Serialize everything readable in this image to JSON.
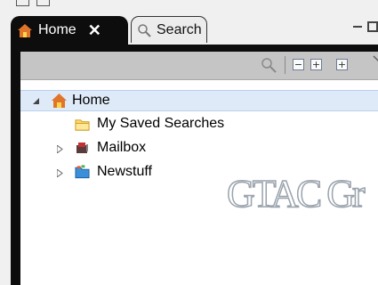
{
  "tabs": [
    {
      "label": "Home",
      "close": "✕",
      "icon": "home-icon",
      "active": true
    },
    {
      "label": "Search",
      "icon": "search-icon",
      "active": false
    }
  ],
  "toolbar": {
    "buttons": [
      "search-icon",
      "collapse-all-icon",
      "expand-icon",
      "expand-all-icon",
      "view-menu-icon"
    ],
    "collapse_glyph": "−",
    "expand_glyph": "+",
    "expand_all_glyph": "+"
  },
  "tree": {
    "items": [
      {
        "label": "Home",
        "icon": "home-icon",
        "expanded": true,
        "selected": true
      },
      {
        "label": "My Saved Searches",
        "icon": "folder-icon"
      },
      {
        "label": "Mailbox",
        "icon": "mailbox-icon",
        "expanded": false
      },
      {
        "label": "Newstuff",
        "icon": "folder-icon",
        "expanded": false
      }
    ]
  },
  "watermark": "GTAC Gr",
  "colors": {
    "accent": "#3cc0c0",
    "tab_dark": "#0d0d0d",
    "selection": "#dfeaf8"
  }
}
